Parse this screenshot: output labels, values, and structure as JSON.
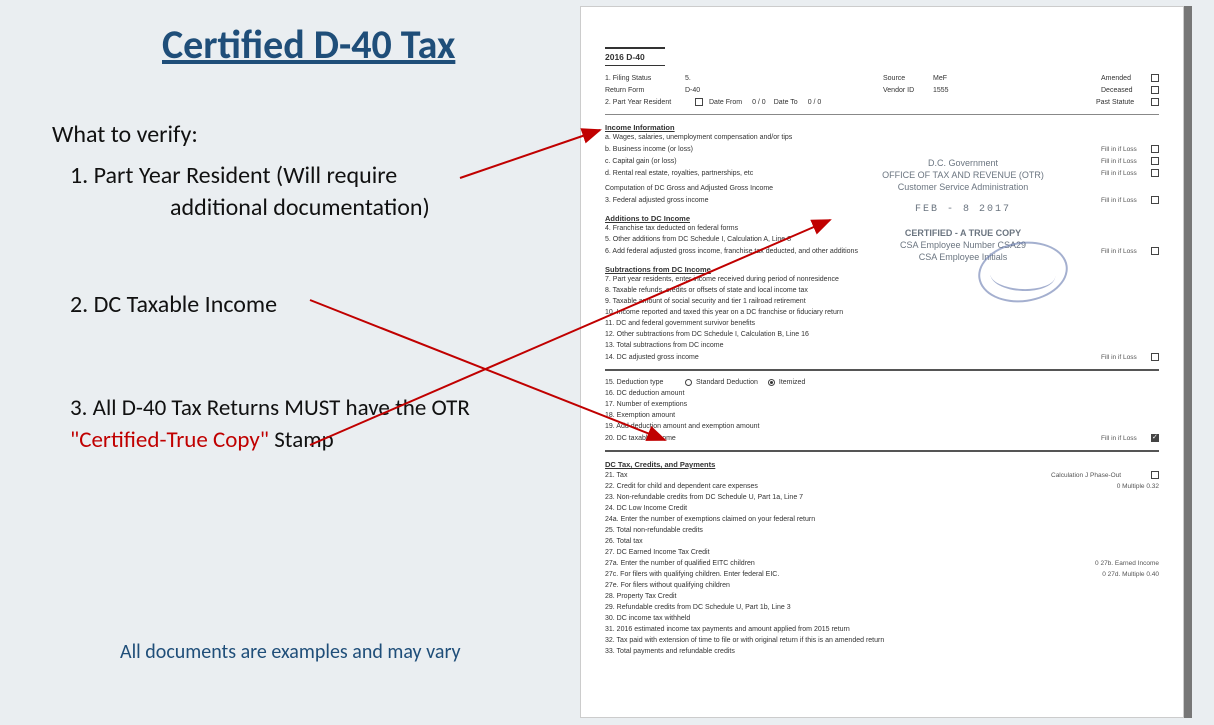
{
  "title": "Certified D-40 Tax",
  "intro": "What to verify:",
  "item1_line1": "1. Part Year Resident (Will require",
  "item1_line2": "additional documentation)",
  "item2": "2. DC Taxable Income",
  "item3_part1": "3. All D-40 Tax Returns MUST have the OTR ",
  "item3_red": "\"Certified-True Copy\"",
  "item3_part2": " Stamp",
  "footnote": "All documents are examples and may vary",
  "form": {
    "header": "2016 D-40",
    "filingStatus": {
      "label": "1. Filing Status",
      "value": "5."
    },
    "returnForm": {
      "label": "Return Form",
      "value": "D-40"
    },
    "source": {
      "label": "Source",
      "value": "MeF"
    },
    "vendorId": {
      "label": "Vendor ID",
      "value": "1555"
    },
    "amended": "Amended",
    "deceased": "Deceased",
    "pastStatute": "Past Statute",
    "pyr": {
      "label": "2. Part Year Resident",
      "dateFrom": "Date From",
      "from": "0 / 0",
      "dateTo": "Date To",
      "to": "0 / 0"
    },
    "fillIfLoss": "Fill in if Loss",
    "income": {
      "hdr": "Income Information",
      "a": "a. Wages, salaries, unemployment compensation and/or tips",
      "b": "b. Business income (or loss)",
      "c": "c. Capital gain (or loss)",
      "d": "d. Rental real estate, royalties, partnerships, etc",
      "comp": "Computation of DC Gross and Adjusted Gross Income",
      "l3": "3. Federal adjusted gross income"
    },
    "additions": {
      "hdr": "Additions to DC Income",
      "l4": "4. Franchise tax deducted on federal forms",
      "l5": "5. Other additions from DC Schedule I, Calculation A, Line 8",
      "l6": "6. Add federal adjusted gross income, franchise tax deducted, and other additions"
    },
    "subtractions": {
      "hdr": "Subtractions from DC Income",
      "l7": "7. Part year residents, enter income received during period of nonresidence",
      "l8": "8. Taxable refunds, credits or offsets of state and local income tax",
      "l9": "9. Taxable amount of social security and tier 1 railroad retirement",
      "l10": "10. Income reported and taxed this year on a DC franchise or fiduciary return",
      "l11": "11. DC and federal government survivor benefits",
      "l12": "12. Other subtractions from DC Schedule I, Calculation B, Line 16",
      "l13": "13. Total subtractions from DC income",
      "l14": "14. DC adjusted gross income"
    },
    "deduction": {
      "l15": "15. Deduction type",
      "std": "Standard Deduction",
      "itm": "Itemized",
      "l16": "16. DC deduction amount",
      "l17": "17. Number of exemptions",
      "l18": "18. Exemption amount",
      "l19": "19. Add deduction amount and exemption amount",
      "l20": "20. DC taxable income"
    },
    "tax": {
      "hdr": "DC Tax, Credits, and Payments",
      "l21": "21. Tax",
      "l21b": "Calculation J Phase-Out",
      "l22": "22. Credit for child and dependent care expenses",
      "l22b": "0   Multiple 0.32",
      "l23": "23. Non-refundable credits from DC Schedule U, Part 1a, Line 7",
      "l24": "24. DC Low Income Credit",
      "l24a": "24a. Enter the number of exemptions claimed on your federal return",
      "l25": "25. Total non-refundable credits",
      "l26": "26. Total tax",
      "l27": "27. DC Earned Income Tax Credit",
      "l27a": "27a. Enter the number of qualified EITC children",
      "l27a_r": "0   27b. Earned Income",
      "l27c": "27c. For filers with qualifying children. Enter federal EIC.",
      "l27c_r": "0   27d. Multiple 0.40",
      "l27e": "27e. For filers without qualifying children",
      "l28": "28. Property Tax Credit",
      "l29": "29. Refundable credits from DC Schedule U, Part 1b, Line 3",
      "l30": "30. DC income tax withheld",
      "l31": "31. 2016 estimated income tax payments and amount applied from 2015 return",
      "l32": "32. Tax paid with extension of time to file or with original return if this is an amended return",
      "l33": "33. Total payments and refundable credits"
    },
    "stamp": {
      "l1": "D.C. Government",
      "l2": "OFFICE OF TAX AND REVENUE (OTR)",
      "l3": "Customer Service Administration",
      "date": "FEB - 8 2017",
      "cert": "CERTIFIED - A TRUE COPY",
      "emp1": "CSA Employee Number CSA29",
      "emp2": "CSA Employee Initials"
    }
  }
}
